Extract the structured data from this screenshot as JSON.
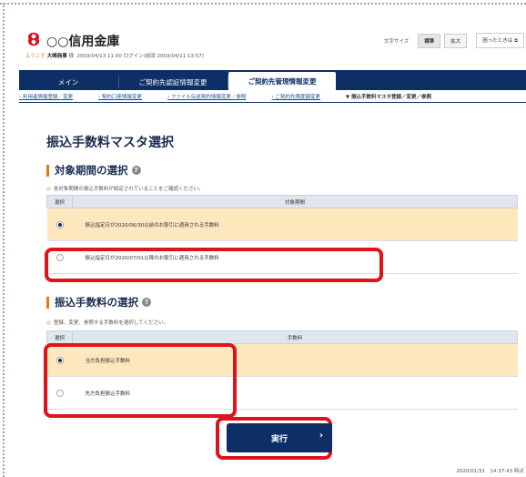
{
  "header": {
    "bank_name": "○○信用金庫",
    "welcome_prefix": "ようこそ",
    "user_name": "大崎商事",
    "welcome_suffix": "様",
    "login_info": "2003/04/13 11:00 ログイン(前回 2003/04/11 13:57)",
    "font_size_label": "文字サイズ",
    "font_standard": "標準",
    "font_large": "拡大",
    "help_label": "困ったときは"
  },
  "nav": {
    "tabs": [
      {
        "label": "メイン"
      },
      {
        "label": "ご契約先認証情報変更"
      },
      {
        "label": "ご契約先管理情報変更"
      }
    ]
  },
  "subnav": {
    "items": [
      "利用者情報登録／変更",
      "契約口座情報変更",
      "ファイル伝送契約情報変更／参照",
      "ご契約先限度額変更",
      "▼ 振込手数料マスタ登録／変更／参照"
    ]
  },
  "main": {
    "title": "振込手数料マスタ選択",
    "section1": {
      "title": "対象期間の選択",
      "note": "各対象期間の振込手数料が設定されていることをご確認ください。",
      "col_select": "選択",
      "col_value": "対象期間",
      "rows": [
        {
          "text": "振込指定日が2020/06/30以前のお取引に適用される手数料",
          "selected": true
        },
        {
          "text": "振込指定日が2020/07/01以降のお取引に適用される手数料",
          "selected": false
        }
      ]
    },
    "section2": {
      "title": "振込手数料の選択",
      "note": "登録、変更、参照する手数料を選択してください。",
      "col_select": "選択",
      "col_value": "手数料",
      "rows": [
        {
          "text": "当方負担振込手数料",
          "selected": true
        },
        {
          "text": "先方負担振込手数料",
          "selected": false
        }
      ]
    },
    "execute_label": "実行",
    "execute_arrow": "›",
    "timestamp": "2020/01/31　14:37:43 時点"
  },
  "colors": {
    "navy": "#0d2f66",
    "accent_orange": "#e07b1a",
    "highlight_row": "#fde7bd",
    "annotation_red": "#e0121b"
  }
}
